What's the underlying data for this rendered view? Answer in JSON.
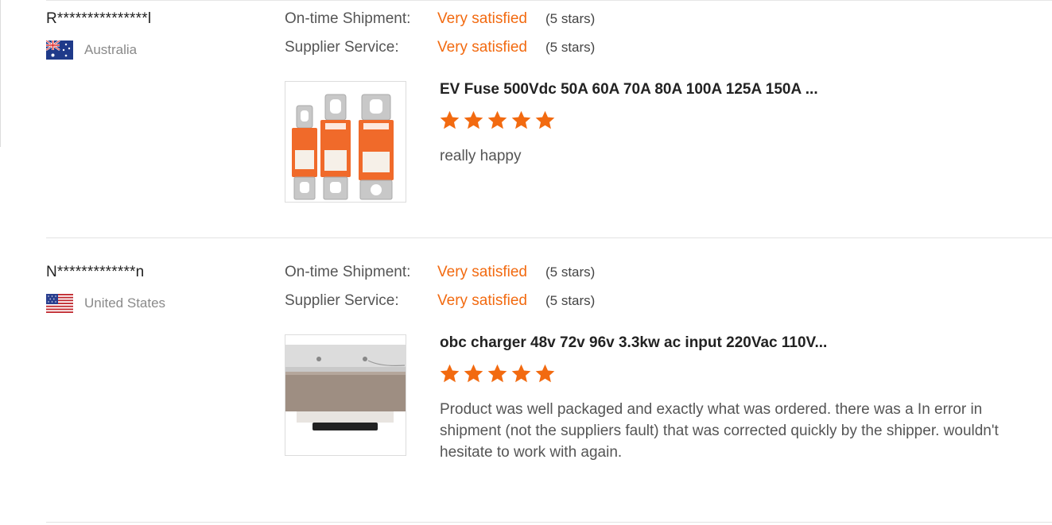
{
  "reviews": [
    {
      "buyer_name": "R***************l",
      "country": "Australia",
      "flag_icon": "australia-flag-icon",
      "ontime_label": "On-time Shipment:",
      "ontime_value": "Very satisfied",
      "ontime_stars": "(5 stars)",
      "service_label": "Supplier Service:",
      "service_value": "Very satisfied",
      "service_stars": "(5 stars)",
      "product_title": "EV Fuse 500Vdc 50A 60A 70A 80A 100A 125A 150A ...",
      "product_image_icon": "ev-fuse-product-image",
      "rating": 5,
      "review_text": "really happy"
    },
    {
      "buyer_name": "N*************n",
      "country": "United States",
      "flag_icon": "united-states-flag-icon",
      "ontime_label": "On-time Shipment:",
      "ontime_value": "Very satisfied",
      "ontime_stars": "(5 stars)",
      "service_label": "Supplier Service:",
      "service_value": "Very satisfied",
      "service_stars": "(5 stars)",
      "product_title": "obc charger 48v 72v 96v 3.3kw ac input 220Vac 110V...",
      "product_image_icon": "obc-charger-product-image",
      "rating": 5,
      "review_text": "Product was well packaged and exactly what was ordered.  there was a In error in shipment (not the suppliers fault) that was corrected quickly by the shipper.  wouldn't hesitate to work with again."
    }
  ],
  "colors": {
    "accent": "#f26a10",
    "star": "#f26a10",
    "text_primary": "#222222",
    "text_secondary": "#555555",
    "text_muted": "#8a8a8a",
    "divider": "#e2e2e2"
  }
}
